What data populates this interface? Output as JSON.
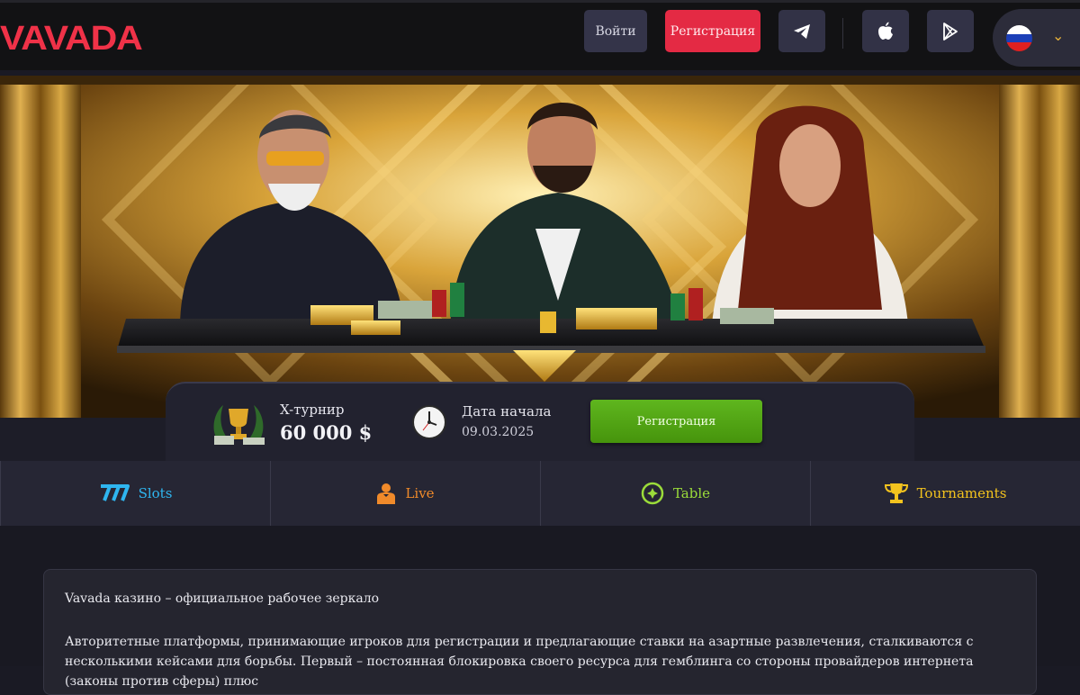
{
  "header": {
    "logo_text": "VAVADA",
    "login_label": "Войти",
    "register_label": "Регистрация",
    "telegram_icon": "telegram-icon",
    "apple_icon": "apple-icon",
    "play_icon": "google-play-icon",
    "language_flag": "russia-flag-icon",
    "brand_color": "#f03248"
  },
  "tournament": {
    "label": "X-турнир",
    "amount": "60 000 $",
    "date_label": "Дата начала",
    "date_value": "09.03.2025",
    "register_label": "Регистрация",
    "register_color": "#5fb61e"
  },
  "tabs": [
    {
      "label": "Slots",
      "icon": "slots-777-icon",
      "color": "#2fb6f0"
    },
    {
      "label": "Live",
      "icon": "dealer-icon",
      "color": "#f08a2a"
    },
    {
      "label": "Table",
      "icon": "poker-chip-icon",
      "color": "#9bdc3a"
    },
    {
      "label": "Tournaments",
      "icon": "trophy-icon",
      "color": "#f3c31e"
    }
  ],
  "article": {
    "title": "Vavada казино – официальное рабочее зеркало",
    "paragraph": "Авторитетные платформы, принимающие игроков для регистрации и предлагающие ставки на азартные развлечения, сталкиваются с несколькими кейсами для борьбы. Первый – постоянная блокировка своего ресурса для гемблинга со стороны провайдеров интернета (законы против сферы) плюс"
  }
}
